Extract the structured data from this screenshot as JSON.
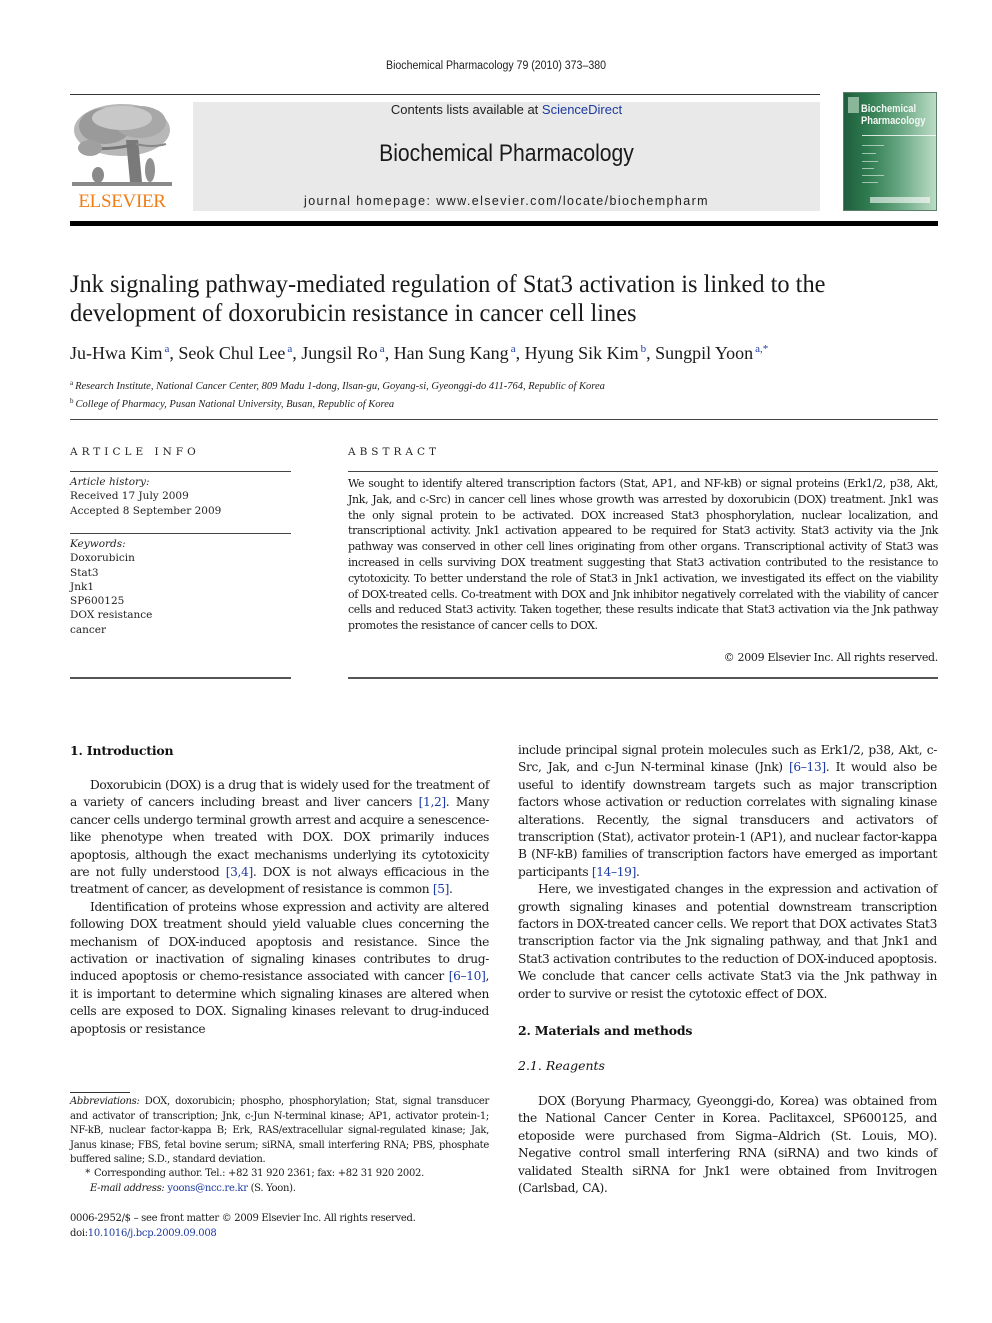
{
  "running_header": "Biochemical Pharmacology 79 (2010) 373–380",
  "masthead": {
    "publisher": "ELSEVIER",
    "contents_prefix": "Contents lists available at ",
    "contents_link": "ScienceDirect",
    "journal_name": "Biochemical Pharmacology",
    "homepage": "journal homepage: www.elsevier.com/locate/biochempharm",
    "cover_title_line1": "Biochemical",
    "cover_title_line2": "Pharmacology"
  },
  "colors": {
    "link": "#1c3aa0",
    "elsevier_orange": "#f07e18",
    "masthead_band": "#e9e9e9",
    "cover_green": "#2e7a4f"
  },
  "article": {
    "title": "Jnk signaling pathway-mediated regulation of Stat3 activation is linked to the development of doxorubicin resistance in cancer cell lines",
    "authors": [
      {
        "name": "Ju-Hwa Kim",
        "aff": "a"
      },
      {
        "name": "Seok Chul Lee",
        "aff": "a"
      },
      {
        "name": "Jungsil Ro",
        "aff": "a"
      },
      {
        "name": "Han Sung Kang",
        "aff": "a"
      },
      {
        "name": "Hyung Sik Kim",
        "aff": "b"
      },
      {
        "name": "Sungpil Yoon",
        "aff": "a,*"
      }
    ],
    "affiliations": [
      {
        "mark": "a",
        "text": "Research Institute, National Cancer Center, 809 Madu 1-dong, Ilsan-gu, Goyang-si, Gyeonggi-do 411-764, Republic of Korea"
      },
      {
        "mark": "b",
        "text": "College of Pharmacy, Pusan National University, Busan, Republic of Korea"
      }
    ]
  },
  "article_info": {
    "heading": "ARTICLE INFO",
    "history_label": "Article history:",
    "received": "Received 17 July 2009",
    "accepted": "Accepted 8 September 2009",
    "keywords_label": "Keywords:",
    "keywords": [
      "Doxorubicin",
      "Stat3",
      "Jnk1",
      "SP600125",
      "DOX resistance",
      "cancer"
    ]
  },
  "abstract": {
    "heading": "ABSTRACT",
    "text": "We sought to identify altered transcription factors (Stat, AP1, and NF-kB) or signal proteins (Erk1/2, p38, Akt, Jnk, Jak, and c-Src) in cancer cell lines whose growth was arrested by doxorubicin (DOX) treatment. Jnk1 was the only signal protein to be activated. DOX increased Stat3 phosphorylation, nuclear localization, and transcriptional activity. Jnk1 activation appeared to be required for Stat3 activity. Stat3 activity via the Jnk pathway was conserved in other cell lines originating from other organs. Transcriptional activity of Stat3 was increased in cells surviving DOX treatment suggesting that Stat3 activation contributed to the resistance to cytotoxicity. To better understand the role of Stat3 in Jnk1 activation, we investigated its effect on the viability of DOX-treated cells. Co-treatment with DOX and Jnk inhibitor negatively correlated with the viability of cancer cells and reduced Stat3 activity. Taken together, these results indicate that Stat3 activation via the Jnk pathway promotes the resistance of cancer cells to DOX.",
    "copyright": "© 2009 Elsevier Inc. All rights reserved."
  },
  "sections": {
    "intro": {
      "heading": "1. Introduction",
      "p1": [
        {
          "t": "Doxorubicin (DOX) is a drug that is widely used for the treatment of a variety of cancers including breast and liver cancers "
        },
        {
          "ref": "[1,2]"
        },
        {
          "t": ". Many cancer cells undergo terminal growth arrest and acquire a senescence-like phenotype when treated with DOX. DOX primarily induces apoptosis, although the exact mechanisms underlying its cytotoxicity are not fully understood "
        },
        {
          "ref": "[3,4]"
        },
        {
          "t": ". DOX is not always efficacious in the treatment of cancer, as development of resistance is common "
        },
        {
          "ref": "[5]"
        },
        {
          "t": "."
        }
      ],
      "p2": [
        {
          "t": "Identification of proteins whose expression and activity are altered following DOX treatment should yield valuable clues concerning the mechanism of DOX-induced apoptosis and resistance. Since the activation or inactivation of signaling kinases contributes to drug-induced apoptosis or chemo-resistance associated with cancer "
        },
        {
          "ref": "[6–10]"
        },
        {
          "t": ", it is important to determine which signaling kinases are altered when cells are exposed to DOX. Signaling kinases relevant to drug-induced apoptosis or resistance include principal signal protein molecules such as Erk1/2, p38, Akt, c-Src, Jak, and c-Jun N-terminal kinase (Jnk) "
        },
        {
          "ref": "[6–13]"
        },
        {
          "t": ". It would also be useful to identify downstream targets such as major transcription factors whose activation or reduction correlates with signaling kinase alterations. Recently, the signal transducers and activators of transcription (Stat), activator protein-1 (AP1), and nuclear factor-kappa B (NF-kB) families of transcription factors have emerged as important participants "
        },
        {
          "ref": "[14–19]"
        },
        {
          "t": "."
        }
      ],
      "p3": "Here, we investigated changes in the expression and activation of growth signaling kinases and potential downstream transcription factors in DOX-treated cancer cells. We report that DOX activates Stat3 transcription factor via the Jnk signaling pathway, and that Jnk1 and Stat3 activation contributes to the reduction of DOX-induced apoptosis. We conclude that cancer cells activate Stat3 via the Jnk pathway in order to survive or resist the cytotoxic effect of DOX."
    },
    "methods": {
      "heading": "2. Materials and methods",
      "sub_heading": "2.1. Reagents",
      "reagents": "DOX (Boryung Pharmacy, Gyeonggi-do, Korea) was obtained from the National Cancer Center in Korea. Paclitaxcel, SP600125, and etoposide were purchased from Sigma–Aldrich (St. Louis, MO). Negative control small interfering RNA (siRNA) and two kinds of validated Stealth siRNA for Jnk1 were obtained from Invitrogen (Carlsbad, CA)."
    }
  },
  "footnotes": {
    "abbrev_label": "Abbreviations:",
    "abbrev_text": " DOX, doxorubicin; phospho, phosphorylation; Stat, signal transducer and activator of transcription; Jnk, c-Jun N-terminal kinase; AP1, activator protein-1; NF-kB, nuclear factor-kappa B; Erk, RAS/extracellular signal-regulated kinase; Jak, Janus kinase; FBS, fetal bovine serum; siRNA, small interfering RNA; PBS, phosphate buffered saline; S.D., standard deviation.",
    "corr_mark": "*",
    "corr_text": "Corresponding author. Tel.: +82 31 920 2361; fax: +82 31 920 2002.",
    "email_label": "E-mail address:",
    "email": "yoons@ncc.re.kr",
    "email_suffix": " (S. Yoon).",
    "front_matter": "0006-2952/$ – see front matter © 2009 Elsevier Inc. All rights reserved.",
    "doi_prefix": "doi:",
    "doi": "10.1016/j.bcp.2009.09.008"
  }
}
